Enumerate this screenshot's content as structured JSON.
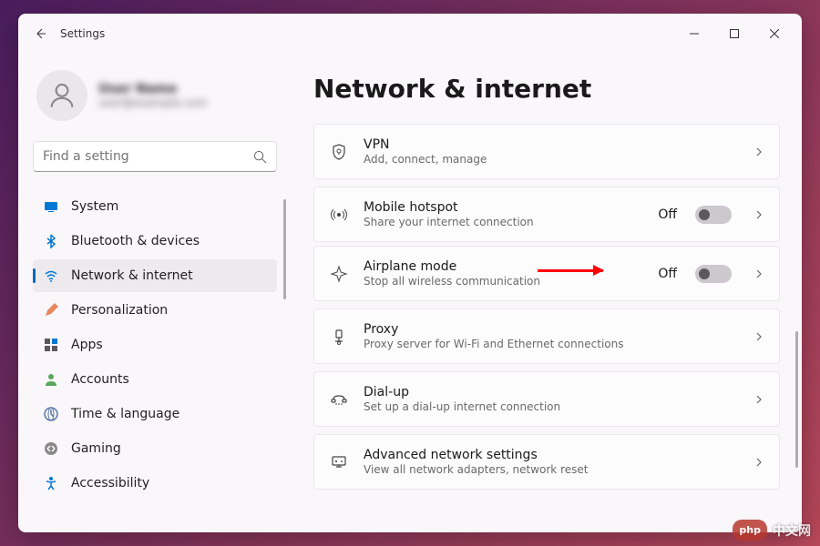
{
  "window": {
    "title": "Settings"
  },
  "profile": {
    "name": "User Name",
    "email": "user@example.com"
  },
  "search": {
    "placeholder": "Find a setting"
  },
  "nav": {
    "items": [
      {
        "label": "System",
        "icon": "system-icon",
        "color": "#0078d4"
      },
      {
        "label": "Bluetooth & devices",
        "icon": "bluetooth-icon",
        "color": "#0078d4"
      },
      {
        "label": "Network & internet",
        "icon": "wifi-icon",
        "color": "#0078d4",
        "active": true
      },
      {
        "label": "Personalization",
        "icon": "personalization-icon",
        "color": "#e8895f"
      },
      {
        "label": "Apps",
        "icon": "apps-icon",
        "color": "#5a5a5a"
      },
      {
        "label": "Accounts",
        "icon": "accounts-icon",
        "color": "#5aa65a"
      },
      {
        "label": "Time & language",
        "icon": "time-language-icon",
        "color": "#5a7aa6"
      },
      {
        "label": "Gaming",
        "icon": "gaming-icon",
        "color": "#888888"
      },
      {
        "label": "Accessibility",
        "icon": "accessibility-icon",
        "color": "#0078d4"
      }
    ]
  },
  "page": {
    "heading": "Network & internet"
  },
  "cards": [
    {
      "title": "VPN",
      "desc": "Add, connect, manage",
      "icon": "shield-icon"
    },
    {
      "title": "Mobile hotspot",
      "desc": "Share your internet connection",
      "icon": "hotspot-icon",
      "status": "Off",
      "toggle": false
    },
    {
      "title": "Airplane mode",
      "desc": "Stop all wireless communication",
      "icon": "airplane-icon",
      "status": "Off",
      "toggle": false
    },
    {
      "title": "Proxy",
      "desc": "Proxy server for Wi-Fi and Ethernet connections",
      "icon": "proxy-icon"
    },
    {
      "title": "Dial-up",
      "desc": "Set up a dial-up internet connection",
      "icon": "dialup-icon"
    },
    {
      "title": "Advanced network settings",
      "desc": "View all network adapters, network reset",
      "icon": "advanced-network-icon"
    }
  ],
  "watermark": {
    "badge": "php",
    "text": "中文网"
  }
}
